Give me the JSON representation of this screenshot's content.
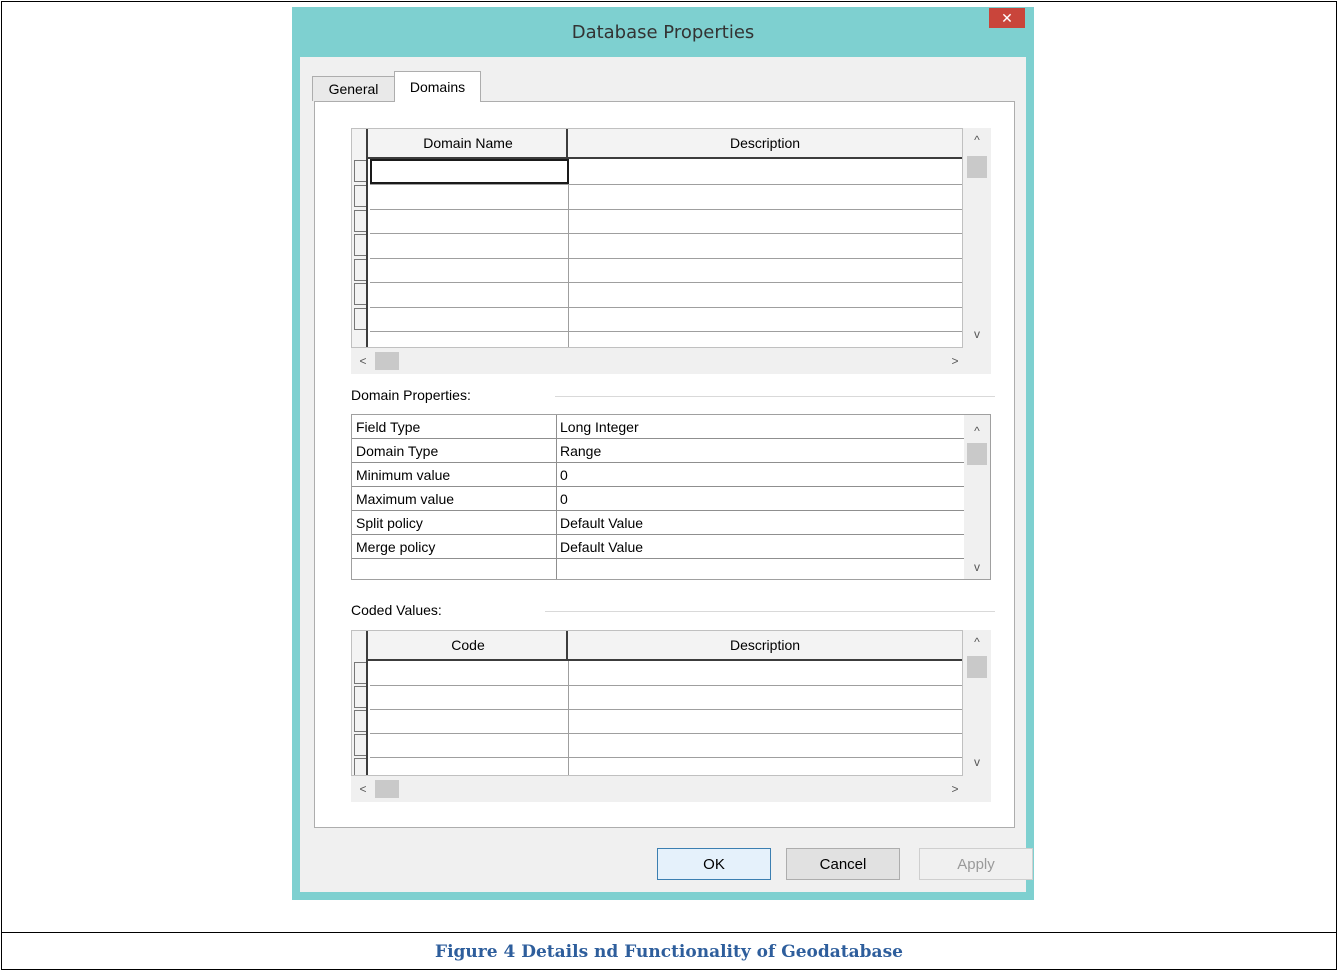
{
  "dialog": {
    "title": "Database Properties",
    "close_symbol": "✕"
  },
  "tabs": [
    {
      "label": "General"
    },
    {
      "label": "Domains"
    }
  ],
  "domains_grid": {
    "columns": [
      "Domain Name",
      "Description"
    ],
    "rows": [
      [
        "",
        ""
      ],
      [
        "",
        ""
      ],
      [
        "",
        ""
      ],
      [
        "",
        ""
      ],
      [
        "",
        ""
      ],
      [
        "",
        ""
      ],
      [
        "",
        ""
      ]
    ]
  },
  "domain_properties": {
    "label": "Domain Properties:",
    "rows": [
      {
        "name": "Field Type",
        "value": "Long Integer"
      },
      {
        "name": "Domain Type",
        "value": "Range"
      },
      {
        "name": "Minimum value",
        "value": "0"
      },
      {
        "name": "Maximum value",
        "value": "0"
      },
      {
        "name": "Split policy",
        "value": "Default Value"
      },
      {
        "name": "Merge policy",
        "value": "Default Value"
      }
    ]
  },
  "coded_values": {
    "label": "Coded Values:",
    "columns": [
      "Code",
      "Description"
    ]
  },
  "buttons": {
    "ok": "OK",
    "cancel": "Cancel",
    "apply": "Apply"
  },
  "scroll_arrows": {
    "up": "^",
    "down": "v",
    "left": "<",
    "right": ">"
  },
  "caption": "Figure 4 Details nd Functionality of Geodatabase",
  "colors": {
    "title_bar": "#7ed0d0",
    "close_button": "#c9453b",
    "caption_text": "#2e5e9c"
  }
}
